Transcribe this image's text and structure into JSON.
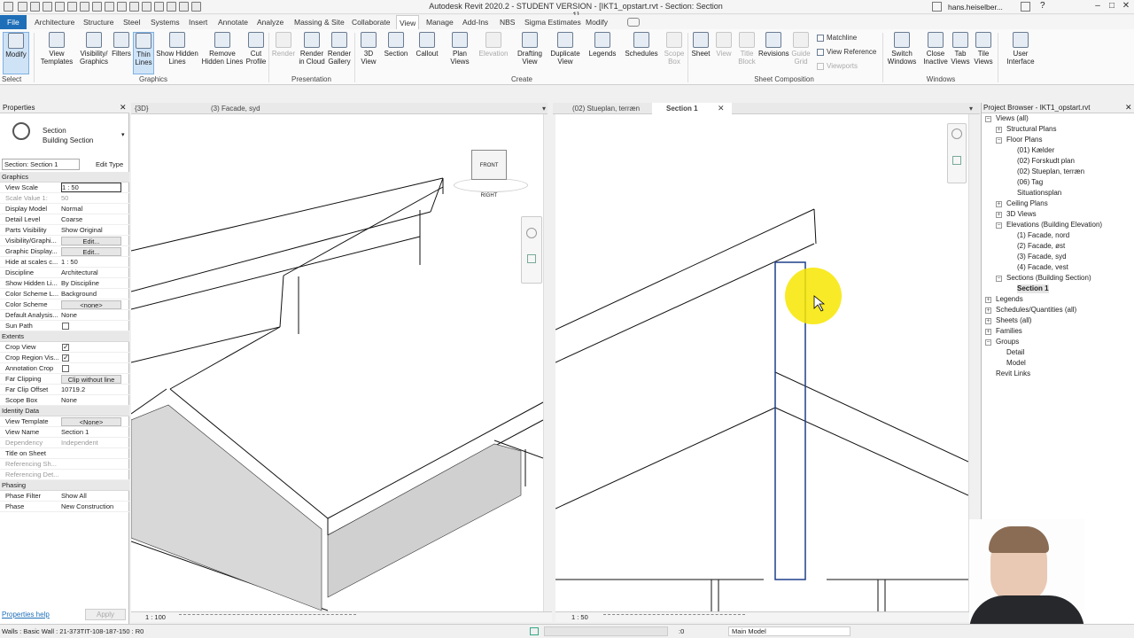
{
  "app": {
    "title": "Autodesk Revit 2020.2 - STUDENT VERSION - [IKT1_opstart.rvt - Section: Section 1]",
    "user": "hans.heiselber..."
  },
  "menu": [
    "File",
    "Architecture",
    "Structure",
    "Steel",
    "Systems",
    "Insert",
    "Annotate",
    "Analyze",
    "Massing & Site",
    "Collaborate",
    "View",
    "Manage",
    "Add-Ins",
    "NBS",
    "Sigma Estimates",
    "Modify"
  ],
  "ribbon": {
    "modify": "Modify",
    "select": "Select",
    "graphics": {
      "label": "Graphics",
      "view_templates": "View Templates",
      "vis_graphics": "Visibility/ Graphics",
      "filters": "Filters",
      "thin_lines": "Thin Lines",
      "show_hidden": "Show Hidden Lines",
      "remove_hidden": "Remove Hidden Lines",
      "cut_profile": "Cut Profile"
    },
    "presentation": {
      "label": "Presentation",
      "render": "Render",
      "render_cloud": "Render in Cloud",
      "render_gallery": "Render Gallery"
    },
    "create": {
      "label": "Create",
      "view3d": "3D View",
      "section": "Section",
      "callout": "Callout",
      "plan_views": "Plan Views",
      "elevation": "Elevation",
      "drafting": "Drafting View",
      "duplicate": "Duplicate View",
      "legends": "Legends",
      "schedules": "Schedules",
      "scope_box": "Scope Box"
    },
    "sheet": {
      "label": "Sheet Composition",
      "sheet": "Sheet",
      "view": "View",
      "title_block": "Title Block",
      "revisions": "Revisions",
      "guide_grid": "Guide Grid",
      "matchline": "Matchline",
      "view_reference": "View Reference",
      "viewports": "Viewports"
    },
    "windows": {
      "label": "Windows",
      "switch": "Switch Windows",
      "close_inactive": "Close Inactive",
      "tab_views": "Tab Views",
      "tile_views": "Tile Views",
      "user_interface": "User Interface"
    }
  },
  "properties": {
    "title": "Properties",
    "type_family": "Section",
    "type_name": "Building Section",
    "selector": "Section: Section 1",
    "edit_type": "Edit Type",
    "groups": {
      "graphics": "Graphics",
      "extents": "Extents",
      "identity": "Identity Data",
      "phasing": "Phasing"
    },
    "rows": {
      "view_scale": [
        "View Scale",
        "1 : 50"
      ],
      "scale_value": [
        "Scale Value    1:",
        "50"
      ],
      "display_model": [
        "Display Model",
        "Normal"
      ],
      "detail_level": [
        "Detail Level",
        "Coarse"
      ],
      "parts_visibility": [
        "Parts Visibility",
        "Show Original"
      ],
      "vis_graphics": [
        "Visibility/Graphi...",
        "Edit..."
      ],
      "graphic_display": [
        "Graphic Display...",
        "Edit..."
      ],
      "hide_scales": [
        "Hide at scales c...",
        "1 : 50"
      ],
      "discipline": [
        "Discipline",
        "Architectural"
      ],
      "show_hidden": [
        "Show Hidden Li...",
        "By Discipline"
      ],
      "color_scheme_loc": [
        "Color Scheme L...",
        "Background"
      ],
      "color_scheme": [
        "Color Scheme",
        "<none>"
      ],
      "default_analysis": [
        "Default Analysis...",
        "None"
      ],
      "sun_path": [
        "Sun Path",
        ""
      ],
      "crop_view": [
        "Crop View",
        ""
      ],
      "crop_region": [
        "Crop Region Vis...",
        ""
      ],
      "annotation_crop": [
        "Annotation Crop",
        ""
      ],
      "far_clipping": [
        "Far Clipping",
        "Clip without line"
      ],
      "far_clip_offset": [
        "Far Clip Offset",
        "10719.2"
      ],
      "scope_box": [
        "Scope Box",
        "None"
      ],
      "view_template": [
        "View Template",
        "<None>"
      ],
      "view_name": [
        "View Name",
        "Section 1"
      ],
      "dependency": [
        "Dependency",
        "Independent"
      ],
      "title_on_sheet": [
        "Title on Sheet",
        ""
      ],
      "ref_sheet": [
        "Referencing Sh...",
        ""
      ],
      "ref_detail": [
        "Referencing Det...",
        ""
      ],
      "phase_filter": [
        "Phase Filter",
        "Show All"
      ],
      "phase": [
        "Phase",
        "New Construction"
      ]
    },
    "help": "Properties help",
    "apply": "Apply"
  },
  "views": {
    "tab_3d": "{3D}",
    "tab_facade": "(3) Facade, syd",
    "tab_plan": "(02) Stueplan, terræn",
    "tab_section": "Section 1",
    "scale_left": "1 : 100",
    "scale_right": "1 : 50",
    "cube_front": "FRONT",
    "cube_right": "RIGHT"
  },
  "browser": {
    "title": "Project Browser - IKT1_opstart.rvt",
    "nodes": [
      {
        "label": "Views (all)"
      },
      {
        "label": "Structural Plans"
      },
      {
        "label": "Floor Plans"
      },
      {
        "label": "(01) Kælder"
      },
      {
        "label": "(02) Forskudt plan"
      },
      {
        "label": "(02) Stueplan, terræn"
      },
      {
        "label": "(06) Tag"
      },
      {
        "label": "Situationsplan"
      },
      {
        "label": "Ceiling Plans"
      },
      {
        "label": "3D Views"
      },
      {
        "label": "Elevations (Building Elevation)"
      },
      {
        "label": "(1) Facade, nord"
      },
      {
        "label": "(2) Facade, øst"
      },
      {
        "label": "(3) Facade, syd"
      },
      {
        "label": "(4) Facade, vest"
      },
      {
        "label": "Sections (Building Section)"
      },
      {
        "label": "Section 1"
      },
      {
        "label": "Legends"
      },
      {
        "label": "Schedules/Quantities (all)"
      },
      {
        "label": "Sheets (all)"
      },
      {
        "label": "Families"
      },
      {
        "label": "Groups"
      },
      {
        "label": "Detail"
      },
      {
        "label": "Model"
      },
      {
        "label": "Revit Links"
      }
    ]
  },
  "status": {
    "text": "Walls : Basic Wall : 21-373TIT-108-187-150 : R0",
    "coord": ":0",
    "model": "Main Model"
  }
}
